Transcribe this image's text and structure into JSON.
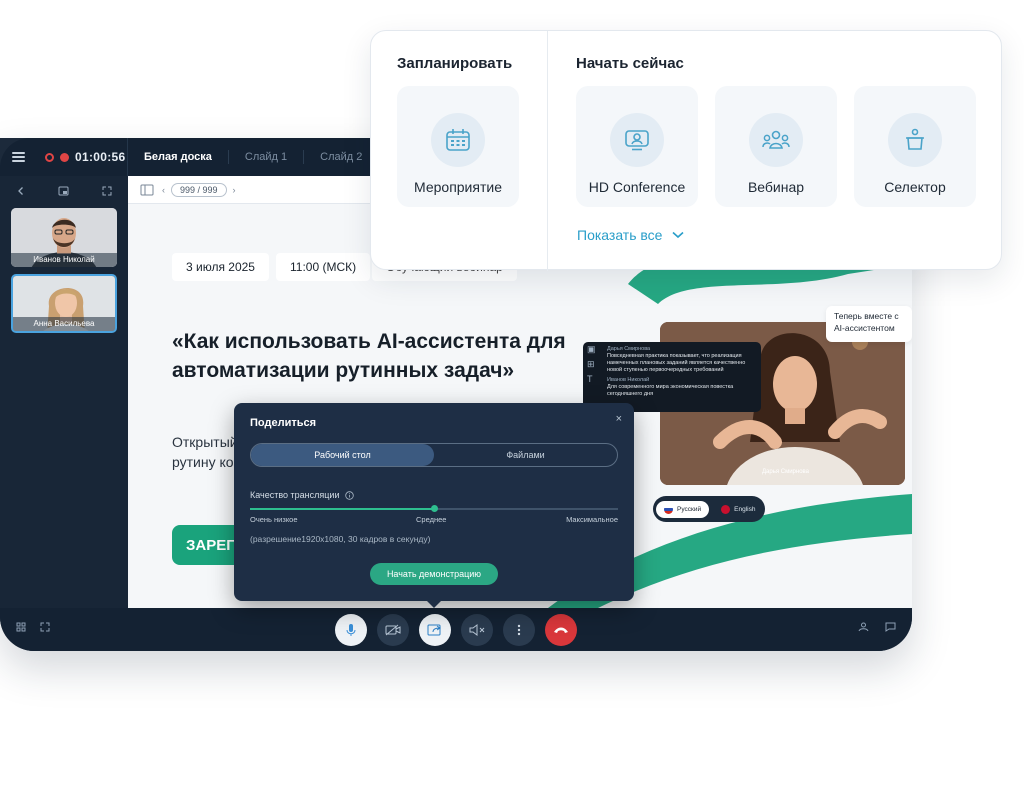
{
  "app": {
    "timer": "01:00:56",
    "tabs": [
      "Белая доска",
      "Слайд 1",
      "Слайд 2"
    ],
    "pager": "999 / 999",
    "participants": [
      {
        "name": "Иванов Николай"
      },
      {
        "name": "Анна Васильева"
      }
    ]
  },
  "slide": {
    "date": "3 июля 2025",
    "time": "11:00 (МСК)",
    "type": "Обучающий вебинар",
    "headline": "«Как использовать AI-ассистента для автоматизации рутинных задач»",
    "subtext": "Открытый вебинар, на котором мы покажем, как делегировать рутину команде.",
    "cta": "ЗАРЕГИСТРИРОВАТЬСЯ",
    "bubble": "Теперь вместе с AI-ассистентом",
    "chat": [
      {
        "author": "Дарья Смирнова",
        "text": "Повседневная практика показывает, что реализация намеченных плановых заданий является качественно новой ступенью первоочередных требований"
      },
      {
        "author": "Иванов Николай",
        "text": "Для современного мира экономическая повестка сегодняшнего дня"
      }
    ],
    "video_name": "Дарья Смирнова",
    "langs": [
      "Русский",
      "English"
    ]
  },
  "share": {
    "title": "Поделиться",
    "close": "×",
    "tabs": [
      "Рабочий стол",
      "Файлами"
    ],
    "quality_label": "Качество трансляции",
    "scale": [
      "Очень низкое",
      "Среднее",
      "Максимальное"
    ],
    "quality_level": 0.5,
    "resolution": "(разрешение1920x1080, 30 кадров в секунду)",
    "start": "Начать демонстрацию"
  },
  "launcher": {
    "plan_title": "Запланировать",
    "now_title": "Начать сейчас",
    "plan_tiles": [
      {
        "label": "Мероприятие",
        "icon": "calendar-icon"
      }
    ],
    "now_tiles": [
      {
        "label": "HD Conference",
        "icon": "video-conference-icon"
      },
      {
        "label": "Вебинар",
        "icon": "webinar-icon"
      },
      {
        "label": "Селектор",
        "icon": "selector-icon"
      }
    ],
    "show_all": "Показать все"
  },
  "colors": {
    "accent": "#2ba784",
    "link": "#2a9ec9",
    "app_bg": "#142233",
    "hangup": "#d9373b"
  }
}
